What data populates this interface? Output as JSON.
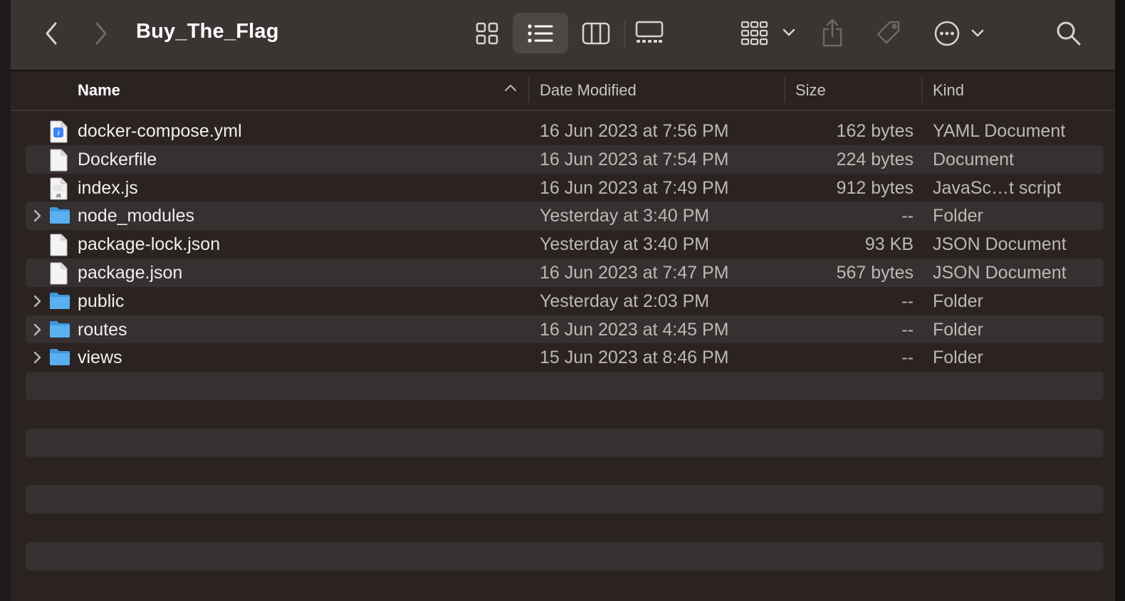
{
  "window": {
    "title": "Buy_The_Flag",
    "toolbar": {
      "back_icon": "chevron-left",
      "forward_icon": "chevron-right",
      "view_modes": [
        "icon-view",
        "list-view",
        "column-view",
        "gallery-view"
      ],
      "selected_view": "list-view",
      "group_icon": "group-by",
      "share_icon": "share",
      "tag_icon": "tag",
      "more_icon": "ellipsis-circle",
      "search_icon": "magnifying-glass"
    }
  },
  "columns": {
    "name": "Name",
    "date": "Date Modified",
    "size": "Size",
    "kind": "Kind",
    "sort": "ascending"
  },
  "files": [
    {
      "name": "docker-compose.yml",
      "date": "16 Jun 2023 at 7:56 PM",
      "size": "162 bytes",
      "kind": "YAML Document",
      "icon": "yaml-file",
      "folder": false
    },
    {
      "name": "Dockerfile",
      "date": "16 Jun 2023 at 7:54 PM",
      "size": "224 bytes",
      "kind": "Document",
      "icon": "document-file",
      "folder": false
    },
    {
      "name": "index.js",
      "date": "16 Jun 2023 at 7:49 PM",
      "size": "912 bytes",
      "kind": "JavaSc…t script",
      "icon": "js-file",
      "folder": false
    },
    {
      "name": "node_modules",
      "date": "Yesterday at 3:40 PM",
      "size": "--",
      "kind": "Folder",
      "icon": "folder",
      "folder": true
    },
    {
      "name": "package-lock.json",
      "date": "Yesterday at 3:40 PM",
      "size": "93 KB",
      "kind": "JSON Document",
      "icon": "document-file",
      "folder": false
    },
    {
      "name": "package.json",
      "date": "16 Jun 2023 at 7:47 PM",
      "size": "567 bytes",
      "kind": "JSON Document",
      "icon": "document-file",
      "folder": false
    },
    {
      "name": "public",
      "date": "Yesterday at 2:03 PM",
      "size": "--",
      "kind": "Folder",
      "icon": "folder",
      "folder": true
    },
    {
      "name": "routes",
      "date": "16 Jun 2023 at 4:45 PM",
      "size": "--",
      "kind": "Folder",
      "icon": "folder",
      "folder": true
    },
    {
      "name": "views",
      "date": "15 Jun 2023 at 8:46 PM",
      "size": "--",
      "kind": "Folder",
      "icon": "folder",
      "folder": true
    }
  ],
  "colors": {
    "toolbar_bg": "#3a3433",
    "list_bg": "#2b2322",
    "stripe": "#363030",
    "folder": "#5ab0ee",
    "accent": "#3b82f6"
  }
}
